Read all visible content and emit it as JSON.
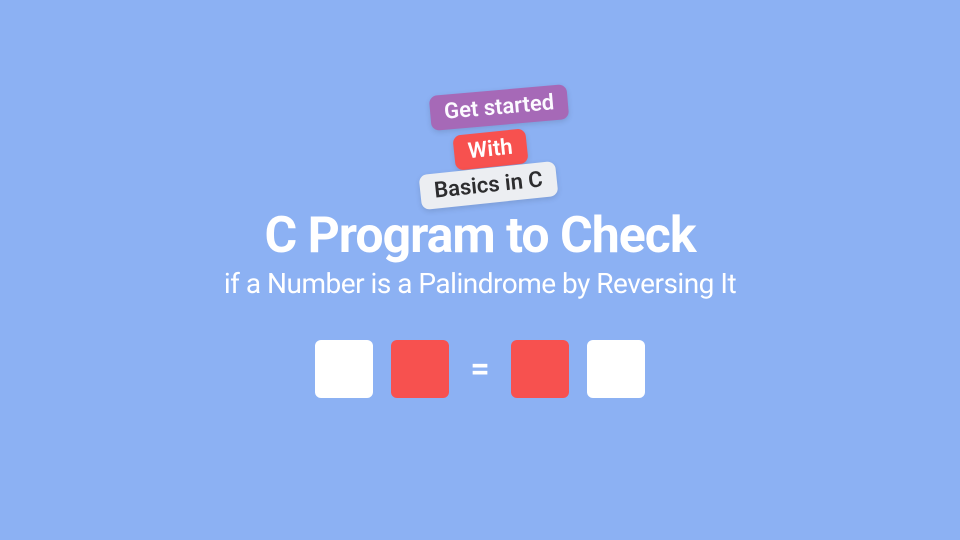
{
  "tags": {
    "purple": "Get started",
    "red": "With",
    "gray": "Basics in C"
  },
  "title": {
    "main": "C Program to Check",
    "sub": "if a Number is a Palindrome by Reversing It"
  },
  "equals": "=",
  "colors": {
    "bg": "#8cb1f3",
    "purple": "#a669b7",
    "red": "#f7514f",
    "gray": "#eceef2"
  }
}
